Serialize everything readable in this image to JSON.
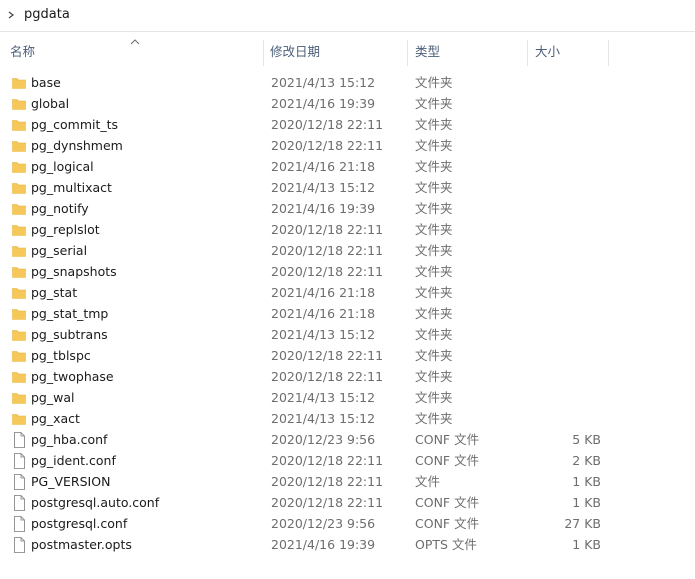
{
  "address": {
    "crumb": "pgdata"
  },
  "columns": {
    "name": "名称",
    "date": "修改日期",
    "type": "类型",
    "size": "大小"
  },
  "colors": {
    "folder": "#f6c85a",
    "folder_dark": "#e2ad34",
    "header_text": "#4c607a"
  },
  "items": [
    {
      "icon": "folder-icon",
      "name": "base",
      "date": "2021/4/13 15:12",
      "type": "文件夹",
      "size": ""
    },
    {
      "icon": "folder-icon",
      "name": "global",
      "date": "2021/4/16 19:39",
      "type": "文件夹",
      "size": ""
    },
    {
      "icon": "folder-icon",
      "name": "pg_commit_ts",
      "date": "2020/12/18 22:11",
      "type": "文件夹",
      "size": ""
    },
    {
      "icon": "folder-icon",
      "name": "pg_dynshmem",
      "date": "2020/12/18 22:11",
      "type": "文件夹",
      "size": ""
    },
    {
      "icon": "folder-icon",
      "name": "pg_logical",
      "date": "2021/4/16 21:18",
      "type": "文件夹",
      "size": ""
    },
    {
      "icon": "folder-icon",
      "name": "pg_multixact",
      "date": "2021/4/13 15:12",
      "type": "文件夹",
      "size": ""
    },
    {
      "icon": "folder-icon",
      "name": "pg_notify",
      "date": "2021/4/16 19:39",
      "type": "文件夹",
      "size": ""
    },
    {
      "icon": "folder-icon",
      "name": "pg_replslot",
      "date": "2020/12/18 22:11",
      "type": "文件夹",
      "size": ""
    },
    {
      "icon": "folder-icon",
      "name": "pg_serial",
      "date": "2020/12/18 22:11",
      "type": "文件夹",
      "size": ""
    },
    {
      "icon": "folder-icon",
      "name": "pg_snapshots",
      "date": "2020/12/18 22:11",
      "type": "文件夹",
      "size": ""
    },
    {
      "icon": "folder-icon",
      "name": "pg_stat",
      "date": "2021/4/16 21:18",
      "type": "文件夹",
      "size": ""
    },
    {
      "icon": "folder-icon",
      "name": "pg_stat_tmp",
      "date": "2021/4/16 21:18",
      "type": "文件夹",
      "size": ""
    },
    {
      "icon": "folder-icon",
      "name": "pg_subtrans",
      "date": "2021/4/13 15:12",
      "type": "文件夹",
      "size": ""
    },
    {
      "icon": "folder-icon",
      "name": "pg_tblspc",
      "date": "2020/12/18 22:11",
      "type": "文件夹",
      "size": ""
    },
    {
      "icon": "folder-icon",
      "name": "pg_twophase",
      "date": "2020/12/18 22:11",
      "type": "文件夹",
      "size": ""
    },
    {
      "icon": "folder-icon",
      "name": "pg_wal",
      "date": "2021/4/13 15:12",
      "type": "文件夹",
      "size": ""
    },
    {
      "icon": "folder-icon",
      "name": "pg_xact",
      "date": "2021/4/13 15:12",
      "type": "文件夹",
      "size": ""
    },
    {
      "icon": "file-icon",
      "name": "pg_hba.conf",
      "date": "2020/12/23 9:56",
      "type": "CONF 文件",
      "size": "5 KB"
    },
    {
      "icon": "file-icon",
      "name": "pg_ident.conf",
      "date": "2020/12/18 22:11",
      "type": "CONF 文件",
      "size": "2 KB"
    },
    {
      "icon": "file-icon",
      "name": "PG_VERSION",
      "date": "2020/12/18 22:11",
      "type": "文件",
      "size": "1 KB"
    },
    {
      "icon": "file-icon",
      "name": "postgresql.auto.conf",
      "date": "2020/12/18 22:11",
      "type": "CONF 文件",
      "size": "1 KB"
    },
    {
      "icon": "file-icon",
      "name": "postgresql.conf",
      "date": "2020/12/23 9:56",
      "type": "CONF 文件",
      "size": "27 KB"
    },
    {
      "icon": "file-icon",
      "name": "postmaster.opts",
      "date": "2021/4/16 19:39",
      "type": "OPTS 文件",
      "size": "1 KB"
    }
  ]
}
